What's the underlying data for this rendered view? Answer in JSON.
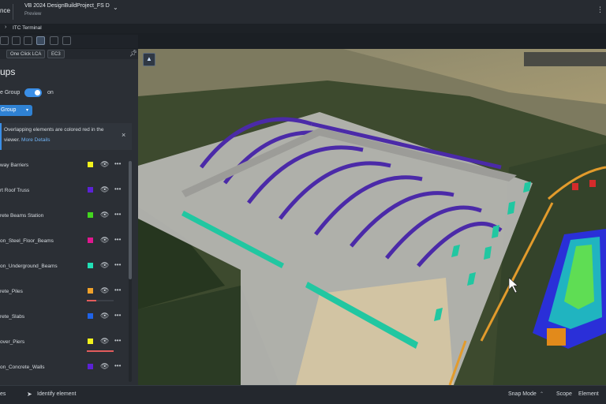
{
  "titlebar": {
    "app_fragment": "nce",
    "project": "VB 2024 DesignBuildProject_FS D",
    "subtitle": "Preview",
    "chevron": "⌄",
    "menu": "⋮"
  },
  "breadcrumb": {
    "chevron": "›",
    "name": "ITC Terminal"
  },
  "panel_tabs": [
    {
      "label": "One Click LCA"
    },
    {
      "label": "EC3"
    }
  ],
  "panel": {
    "title": "ups",
    "toggle_label": "e Group",
    "toggle_on": true,
    "toggle_value": "on",
    "group_button": "Group",
    "info_line1": "Overlapping elements are colored red in the",
    "info_line2_prefix": "viewer.",
    "info_link": "More Details",
    "close": "×",
    "groups": [
      {
        "label": "way Barriers",
        "color": "#f2f21c",
        "bar": 0
      },
      {
        "label": "rt Roof Truss",
        "color": "#5b22d6",
        "bar": 0
      },
      {
        "label": "rete Beams Station",
        "color": "#43d61f",
        "bar": 0
      },
      {
        "label": "on_Steel_Floor_Beams",
        "color": "#e0178f",
        "bar": 0
      },
      {
        "label": "on_Underground_Beams",
        "color": "#21e0b6",
        "bar": 0
      },
      {
        "label": "rete_Piles",
        "color": "#f0a12a",
        "bar": 0.35
      },
      {
        "label": "rete_Slabs",
        "color": "#1f63e8",
        "bar": 0
      },
      {
        "label": "over_Piers",
        "color": "#f2f21c",
        "bar": 1.0
      },
      {
        "label": "on_Concrete_Walls",
        "color": "#5b22d6",
        "bar": 0
      }
    ]
  },
  "statusbar": {
    "left_fragment": "es",
    "pointer_icon": "pointer-icon",
    "identify": "Identify element",
    "snap": "Snap Mode",
    "scope_label": "Scope",
    "scope_value": "Element"
  }
}
